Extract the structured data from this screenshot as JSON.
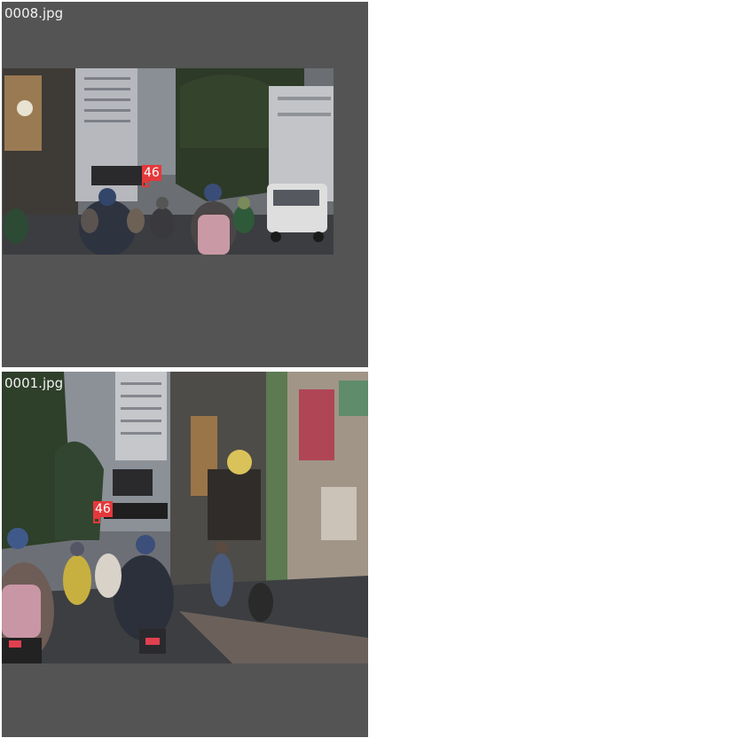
{
  "panels": [
    {
      "filename": "0008.jpg",
      "detections": [
        {
          "id": "46",
          "color": "#e5383b"
        }
      ]
    },
    {
      "filename": "0001.jpg",
      "detections": [
        {
          "id": "46",
          "color": "#e5383b"
        }
      ]
    }
  ],
  "colors": {
    "panel_background": "#545454",
    "page_background": "#ffffff",
    "label_text": "#f2f2f2",
    "box_color": "#e5383b"
  }
}
